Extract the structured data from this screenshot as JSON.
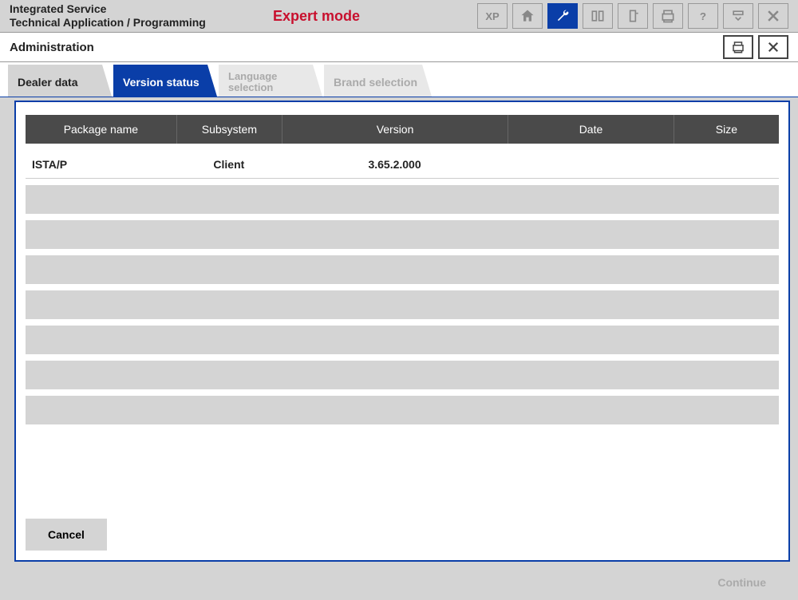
{
  "header": {
    "title_line1": "Integrated Service",
    "title_line2": "Technical Application / Programming",
    "mode": "Expert mode"
  },
  "toolbar": {
    "xp": "XP"
  },
  "subheader": {
    "title": "Administration"
  },
  "tabs": [
    {
      "label": "Dealer data",
      "active": false,
      "disabled": false
    },
    {
      "label": "Version status",
      "active": true,
      "disabled": false
    },
    {
      "label_line1": "Language",
      "label_line2": "selection",
      "active": false,
      "disabled": true
    },
    {
      "label": "Brand selection",
      "active": false,
      "disabled": true
    }
  ],
  "table": {
    "headers": {
      "package": "Package name",
      "subsystem": "Subsystem",
      "version": "Version",
      "date": "Date",
      "size": "Size"
    },
    "rows": [
      {
        "package": "ISTA/P",
        "subsystem": "Client",
        "version": "3.65.2.000",
        "date": "",
        "size": ""
      }
    ],
    "empty_row_count": 7
  },
  "buttons": {
    "cancel": "Cancel",
    "continue": "Continue"
  }
}
